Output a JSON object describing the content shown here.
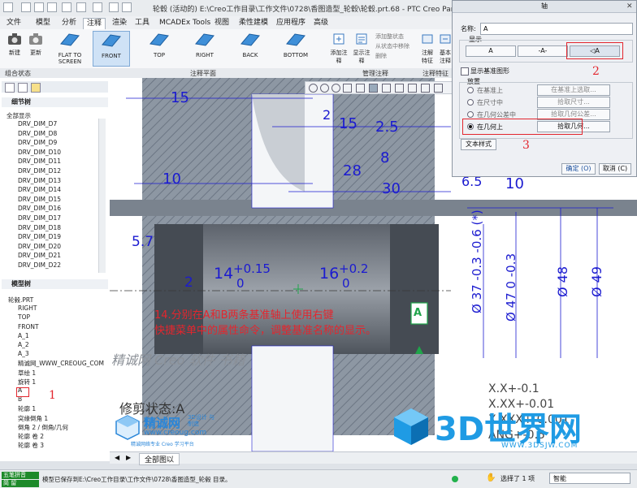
{
  "window": {
    "title": "轮毂 (活动的) E:\\Creo工作目录\\工作文件\\0728\\香图造型_轮毂\\轮毂.prt.68 - PTC Creo Parametric"
  },
  "menu": {
    "tabs": [
      "文件",
      "模型",
      "分析",
      "注释",
      "渲染",
      "工具",
      "MCADEx Tools",
      "视图",
      "柔性建模",
      "应用程序",
      "高级"
    ],
    "active": "注释"
  },
  "ribbon": {
    "new": "新建",
    "update": "更新",
    "views": [
      "FLAT TO SCREEN",
      "FRONT",
      "TOP",
      "RIGHT",
      "BACK",
      "BOTTOM"
    ],
    "annotate_side": [
      "添加注释",
      "显示注释",
      "从状态中移除",
      "添加整状态",
      "删除",
      "试验"
    ],
    "right_1": "注解特征",
    "right_2": "基本注释",
    "groups": [
      "组合状态",
      "注释平面",
      "管理注释",
      "注释特征"
    ]
  },
  "left_panel": {
    "detail_tree": "细节树",
    "detail_all": "全部显示",
    "dims": [
      "DRV_DIM_D7",
      "DRV_DIM_D8",
      "DRV_DIM_D9",
      "DRV_DIM_D10",
      "DRV_DIM_D11",
      "DRV_DIM_D12",
      "DRV_DIM_D13",
      "DRV_DIM_D14",
      "DRV_DIM_D15",
      "DRV_DIM_D16",
      "DRV_DIM_D17",
      "DRV_DIM_D18",
      "DRV_DIM_D19",
      "DRV_DIM_D20",
      "DRV_DIM_D21",
      "DRV_DIM_D22"
    ],
    "model_tree": "模型树",
    "model_items": [
      "轮毂.PRT",
      "RIGHT",
      "TOP",
      "FRONT",
      "A_1",
      "A_2",
      "A_3",
      "精诚网_WWW_CREOUG_COM",
      "草绘 1",
      "旋转 1",
      "A",
      "B",
      "轮廓 1",
      "突缘倒角 1",
      "倒角 2 / 倒角/几何",
      "轮廓 卷 2",
      "轮廓 卷 3"
    ]
  },
  "graphics": {
    "dims_top": [
      "15",
      "2",
      "15",
      "2.5",
      "8",
      "28",
      "30",
      "10",
      "10",
      "6.5"
    ],
    "left_dims": [
      "5.7",
      "2"
    ],
    "shaft_tol_1": {
      "base": "14",
      "upper": "+0.15",
      "lower": "0"
    },
    "shaft_tol_2": {
      "base": "16",
      "upper": "+0.2",
      "lower": "0"
    },
    "vertical_dims": [
      "Ø 37 -0.3 -0.6 (*)",
      "Ø 47 0 -0.3",
      "Ø 48",
      "Ø 49"
    ],
    "tip_line1": "14.分别在A和B两条基准轴上使用右键",
    "tip_line2": "快捷菜单中的属性命令，调整基准名称的显示。",
    "datum_a": "A",
    "watermark": "精诚网 Creo 软件 书籍",
    "trim_state": "修剪状态:A",
    "tolerance_table": [
      "X.X+-0.1",
      "X.XX+-0.01",
      "X.XXX+-0.001",
      "ANG+-0.5"
    ],
    "logo_main": "精诚网",
    "logo_sub": "www.creoug.com",
    "logo_tag": "3D设计 与制造",
    "logo_line": "精诚网络专业 Creo 学习平台",
    "brand_big": "3D世界网",
    "brand_url": "WWW.3DSJW.COM",
    "accent": "#e3262e",
    "dim_color": "#1b1bd0"
  },
  "dialog": {
    "title": "轴",
    "name_label": "名称:",
    "name_value": "A",
    "display_label": "显示",
    "style_buttons": [
      "A",
      "-A-",
      "◁A"
    ],
    "checkbox": "显示基准图形",
    "placement_label": "放置",
    "options": [
      {
        "label": "在基准上",
        "button": "在基准上选取..."
      },
      {
        "label": "在尺寸中",
        "button": "拾取尺寸..."
      },
      {
        "label": "在几何公差中",
        "button": "拾取几何公差..."
      },
      {
        "label": "在几何上",
        "button": "拾取几何..."
      }
    ],
    "text_style": "文本样式",
    "ok": "确定 (O)",
    "cancel": "取消 (C)",
    "step_2": "2",
    "step_3": "3"
  },
  "step_1": "1",
  "tabbar": {
    "label": "全部图以"
  },
  "status": {
    "left1": "五笔拼音",
    "left2": "简 留",
    "message": "模型已保存到E:\\Creo工作目录\\工作文件\\0728\\香图造型_轮毂 目录。",
    "selected": "选择了 1 项",
    "filter": "智能"
  }
}
